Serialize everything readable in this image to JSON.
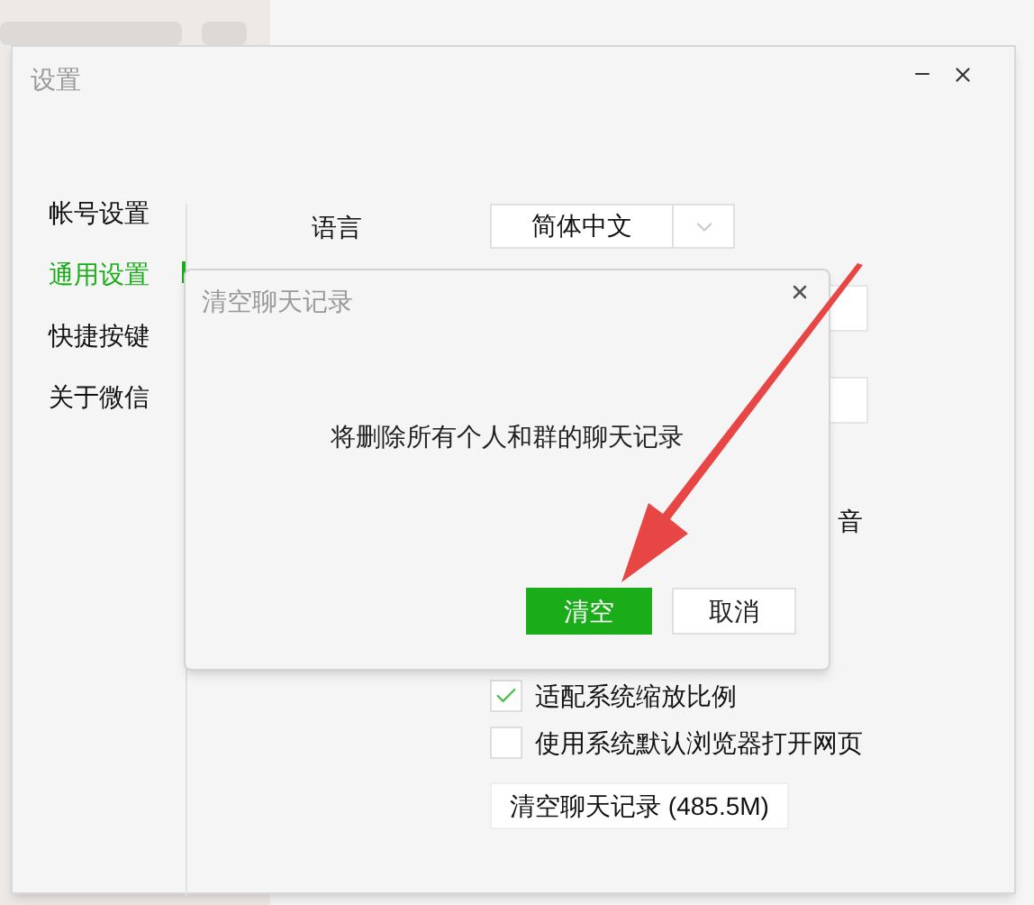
{
  "window": {
    "title": "设置"
  },
  "sidebar": {
    "items": [
      {
        "label": "帐号设置",
        "selected": false
      },
      {
        "label": "通用设置",
        "selected": true
      },
      {
        "label": "快捷按键",
        "selected": false
      },
      {
        "label": "关于微信",
        "selected": false
      }
    ]
  },
  "language": {
    "label": "语言",
    "value": "简体中文"
  },
  "hidden_row_text": "音",
  "options": [
    {
      "label": "适配系统缩放比例",
      "checked": true
    },
    {
      "label": "使用系统默认浏览器打开网页",
      "checked": false
    }
  ],
  "clear_button": "清空聊天记录 (485.5M)",
  "dialog": {
    "title": "清空聊天记录",
    "message": "将删除所有个人和群的聊天记录",
    "confirm": "清空",
    "cancel": "取消"
  }
}
